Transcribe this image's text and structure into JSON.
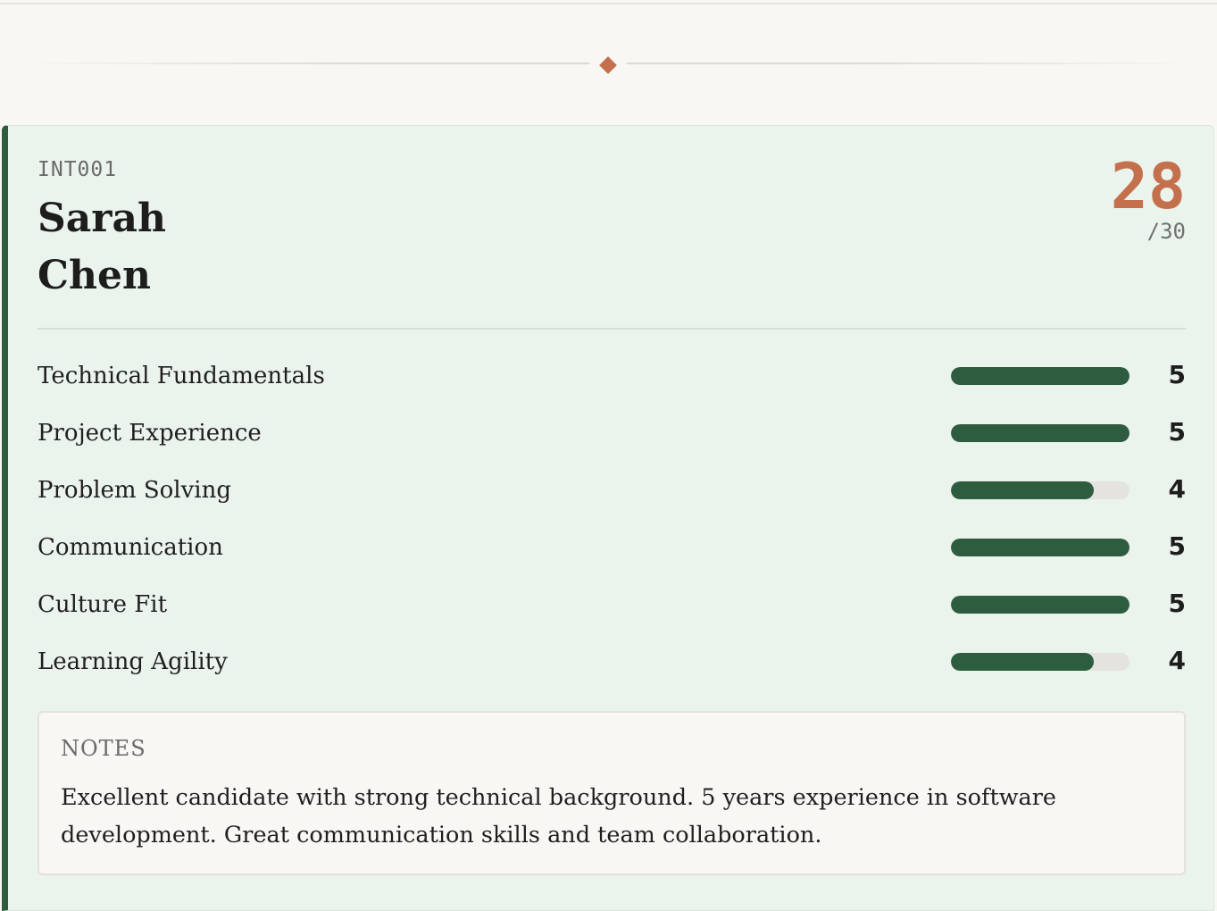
{
  "candidate": {
    "id": "INT001",
    "first_name": "Sarah",
    "last_name": "Chen",
    "score": "28",
    "score_max": "/30"
  },
  "criteria": [
    {
      "label": "Technical Fundamentals",
      "score": "5",
      "fraction": 1.0
    },
    {
      "label": "Project Experience",
      "score": "5",
      "fraction": 1.0
    },
    {
      "label": "Problem Solving",
      "score": "4",
      "fraction": 0.8
    },
    {
      "label": "Communication",
      "score": "5",
      "fraction": 1.0
    },
    {
      "label": "Culture Fit",
      "score": "5",
      "fraction": 1.0
    },
    {
      "label": "Learning Agility",
      "score": "4",
      "fraction": 0.8
    }
  ],
  "notes": {
    "title": "NOTES",
    "text": "Excellent candidate with strong technical background. 5 years experience in software development. Great communication skills and team collaboration."
  },
  "colors": {
    "accent": "#c4704d",
    "primary": "#2e5c3f",
    "card_bg": "#ebf4ec",
    "page_bg": "#f9f7f3"
  }
}
